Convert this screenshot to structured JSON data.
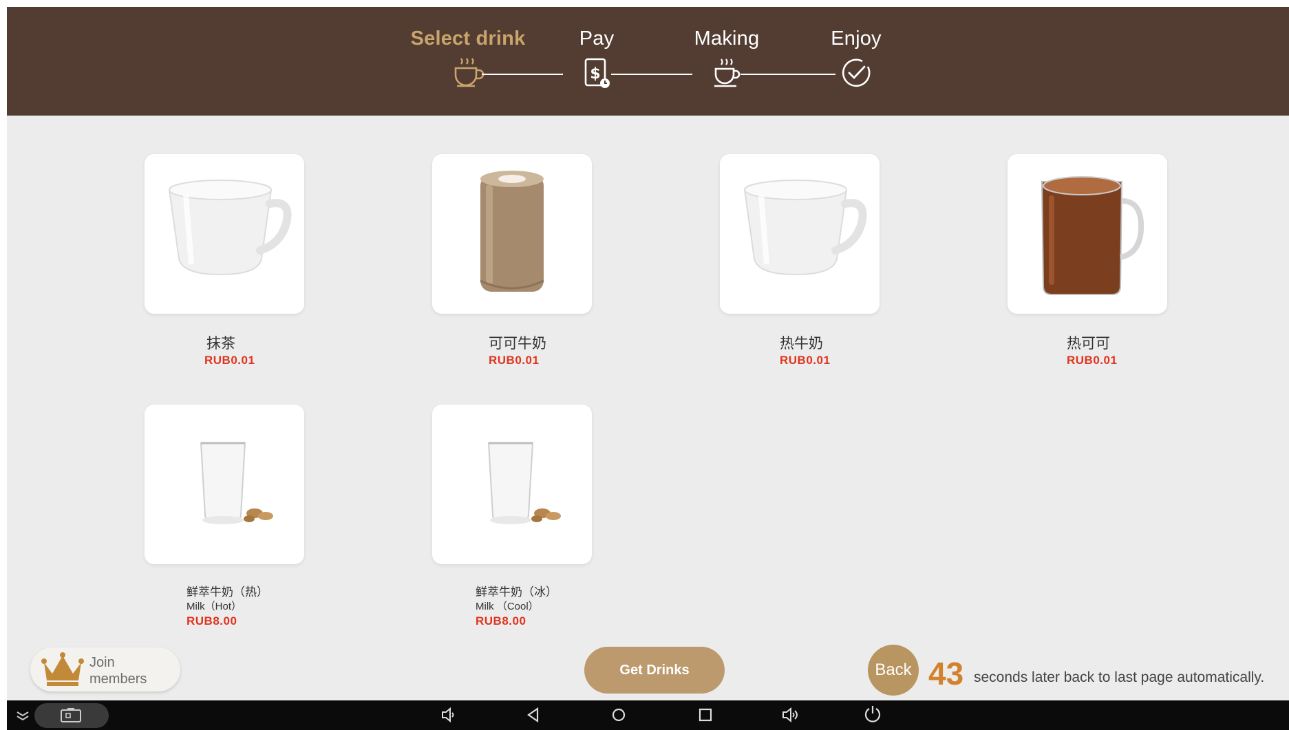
{
  "steps": [
    {
      "label": "Select drink",
      "icon": "coffee-cup-icon",
      "active": true
    },
    {
      "label": "Pay",
      "icon": "payment-icon",
      "active": false
    },
    {
      "label": "Making",
      "icon": "steaming-cup-icon",
      "active": false
    },
    {
      "label": "Enjoy",
      "icon": "check-circle-icon",
      "active": false
    }
  ],
  "drinks": [
    {
      "name": "抹茶",
      "sub": "",
      "price": "RUB0.01",
      "image": "white-mug"
    },
    {
      "name": "可可牛奶",
      "sub": "",
      "price": "RUB0.01",
      "image": "cocoa-milk-glass"
    },
    {
      "name": "热牛奶",
      "sub": "",
      "price": "RUB0.01",
      "image": "white-mug"
    },
    {
      "name": "热可可",
      "sub": "",
      "price": "RUB0.01",
      "image": "cocoa-glass-mug"
    },
    {
      "name": "鲜萃牛奶（热）",
      "sub": "Milk（Hot）",
      "price": "RUB8.00",
      "image": "milk-glass"
    },
    {
      "name": "鲜萃牛奶（冰）",
      "sub": "Milk （Cool）",
      "price": "RUB8.00",
      "image": "milk-glass"
    }
  ],
  "join": {
    "line1": "Join",
    "line2": "members",
    "icon": "crown-icon"
  },
  "get_drinks_label": "Get Drinks",
  "back_label": "Back",
  "countdown_value": "43",
  "countdown_text": "seconds later back to last page automatically.",
  "colors": {
    "header_bg": "#533d33",
    "active_step": "#c9a46b",
    "price": "#e0341e",
    "button": "#bc9a6d",
    "countdown": "#d2822d"
  },
  "navbar": {
    "icons": [
      "expand-icon",
      "screenshot-icon",
      "volume-down-icon",
      "back-icon",
      "home-icon",
      "recents-icon",
      "volume-up-icon",
      "power-icon"
    ]
  }
}
